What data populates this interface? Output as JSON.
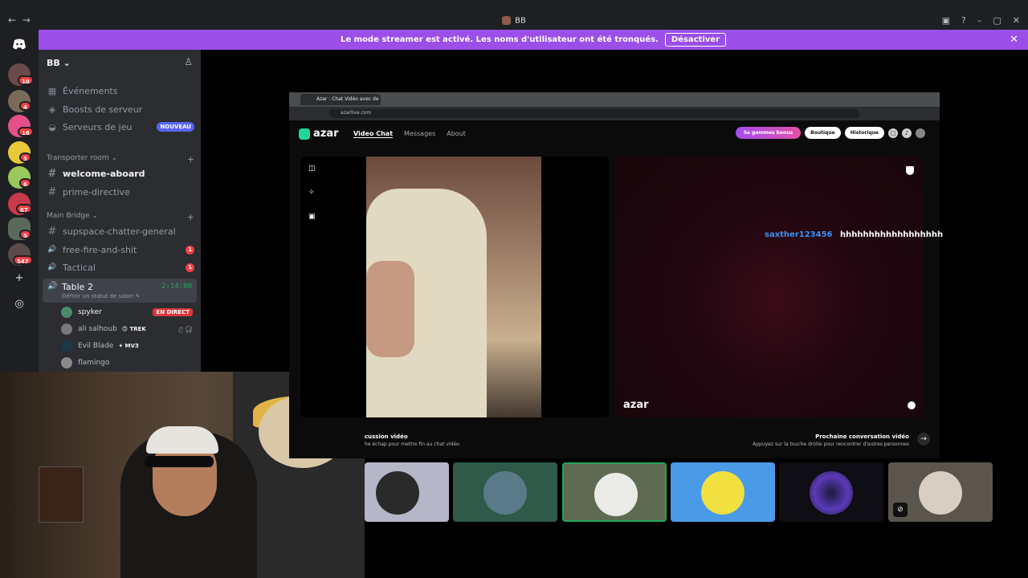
{
  "window": {
    "title": "BB",
    "nav_back": "←",
    "nav_fwd": "→",
    "btn_inbox": "▣",
    "btn_help": "?",
    "btn_min": "–",
    "btn_max": "▢",
    "btn_close": "✕"
  },
  "banner": {
    "text": "Le mode streamer est activé. Les noms d'utilisateur ont été tronqués.",
    "button": "Désactiver",
    "close": "✕"
  },
  "rail": {
    "home_icon": "discord-logo",
    "badges": [
      "10",
      "4",
      "16",
      "5",
      "6",
      "67",
      "5",
      "547"
    ],
    "add_label": "+",
    "explore_label": "◎"
  },
  "sidebar": {
    "server_name": "BB ⌄",
    "invite_icon": "♙",
    "items": [
      {
        "label": "Événements",
        "icon": "▦"
      },
      {
        "label": "Boosts de serveur",
        "icon": "◈"
      },
      {
        "label": "Serveurs de jeu",
        "icon": "◒",
        "pill": "NOUVEAU"
      }
    ],
    "categories": [
      {
        "label": "Transporter room ⌄",
        "plus": "+"
      },
      {
        "label": "Main Bridge ⌄",
        "plus": "+"
      }
    ],
    "channels": [
      {
        "label": "welcome-aboard",
        "icon": "#"
      },
      {
        "label": "prime-directive",
        "icon": "#"
      },
      {
        "label": "supspace-chatter-general",
        "icon": "#"
      },
      {
        "label": "free-fire-and-shit",
        "icon": "🔊",
        "badge": "1"
      },
      {
        "label": "Tactical",
        "icon": "🔊",
        "badge": "1"
      }
    ],
    "active_voice": {
      "name": "Table 2",
      "timer": "2:14:00",
      "status": "Définir un statut de salon ✎",
      "icon": "🔊"
    },
    "voice_users": [
      {
        "name": "spyker",
        "live": "EN DIRECT"
      },
      {
        "name": "ali salhoub",
        "tag": "😊 TREK",
        "mute": "🎙̸ 🎧̸"
      },
      {
        "name": "Evil Blade",
        "tag": "✦ MV3"
      },
      {
        "name": "flamingo"
      }
    ]
  },
  "browser": {
    "tab_title": "Azar : Chat Vidéo avec de",
    "url": "azarlive.com"
  },
  "azar": {
    "logo": "azar",
    "nav": [
      "Video Chat",
      "Messages",
      "About"
    ],
    "gem_button": "5e gemmes bonus",
    "shop_button": "Boutique",
    "history_button": "Historique",
    "chat_user": "saxther123456",
    "chat_message": "hhhhhhhhhhhhhhhhhh",
    "watermark": "azar",
    "left_caption_title": "cussion vidéo",
    "left_caption_sub": "he échap pour mettre fin au chat vidéo.",
    "right_caption_title": "Prochaine conversation vidéo",
    "right_caption_sub": "Appuyez sur la touche droite pour rencontrer d'autres personnes",
    "next_arrow": "→"
  },
  "colors": {
    "accent": "#9b4ee8",
    "brand": "#5865f2",
    "live": "#da373c",
    "speaking": "#23a55a",
    "chat_user": "#3b8ff5"
  }
}
